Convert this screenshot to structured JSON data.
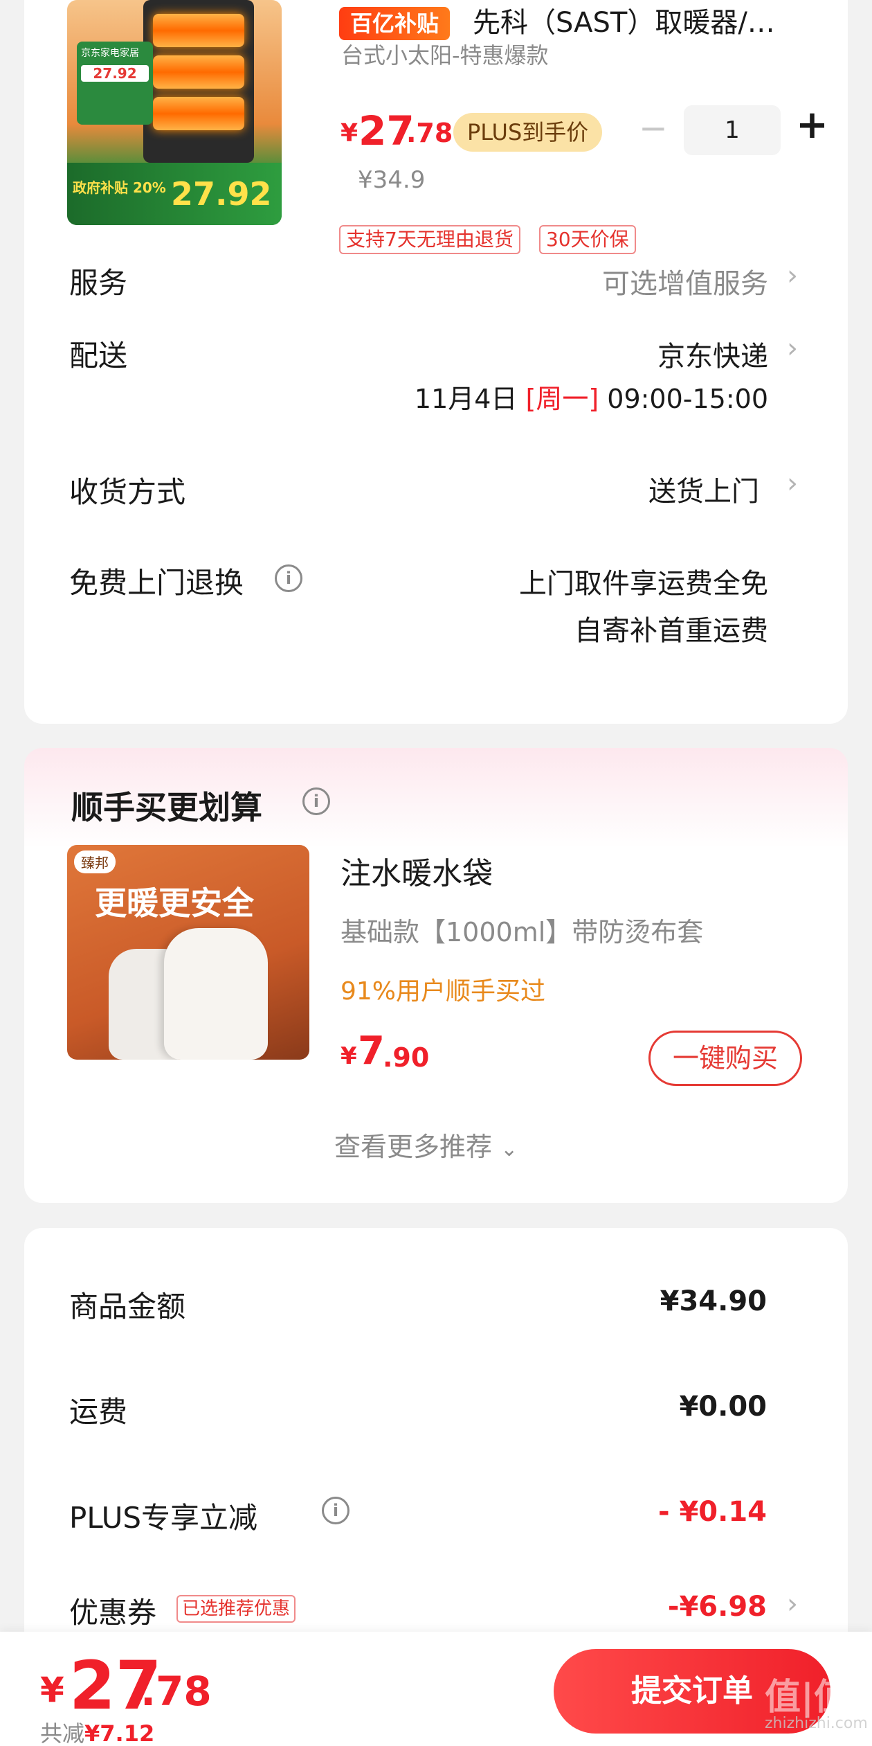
{
  "product": {
    "subsidy_badge": "百亿补贴",
    "title": "先科（SAST）取暖器/…",
    "subtitle": "台式小太阳-特惠爆款",
    "price_currency": "¥",
    "price_int": "27",
    "price_dec": ".78",
    "plus_label": "PLUS到手价",
    "qty_minus": "−",
    "quantity": "1",
    "qty_plus": "+",
    "original_price": "¥34.9",
    "service_tags": [
      "支持7天无理由退货",
      "30天价保"
    ],
    "image_text": {
      "promo_price": "27.92",
      "gov_text": "政府补贴",
      "gov_percent": "20%",
      "brand_tag": "京东家电家居"
    }
  },
  "rows": {
    "service_label": "服务",
    "service_value": "可选增值服务",
    "delivery_label": "配送",
    "delivery_value": "京东快递",
    "delivery_date": "11月4日",
    "delivery_weekday": "[周一]",
    "delivery_time": "09:00-15:00",
    "receive_label": "收货方式",
    "receive_value": "送货上门",
    "return_label": "免费上门退换",
    "return_line1": "上门取件享运费全免",
    "return_line2": "自寄补首重运费"
  },
  "reco": {
    "title": "顺手买更划算",
    "image_slogan": "更暖更安全",
    "image_brand": "臻邦",
    "name": "注水暖水袋",
    "spec": "基础款【1000ml】带防烫布套",
    "stat": "91%用户顺手买过",
    "price_currency": "¥",
    "price_int": "7",
    "price_dec": ".90",
    "buy_label": "一键购买",
    "more_label": "查看更多推荐"
  },
  "summary": {
    "goods_label": "商品金额",
    "goods_value": "¥34.90",
    "shipping_label": "运费",
    "shipping_value": "¥0.00",
    "plus_label": "PLUS专享立减",
    "plus_value": "- ¥0.14",
    "coupon_label": "优惠券",
    "coupon_tag": "已选推荐优惠",
    "coupon_value": "-¥6.98"
  },
  "bottom": {
    "total_currency": "¥",
    "total_int": "27",
    "total_dec": ".78",
    "saved_prefix": "共减",
    "saved_value": "¥7.12",
    "submit_label": "提交订单",
    "watermark": "值|值|值",
    "watermark_sub": "zhizhizhi.com"
  },
  "colors": {
    "accent_red": "#f0202a",
    "plus_gold": "#fbe2a6",
    "stat_orange": "#e8891c"
  }
}
